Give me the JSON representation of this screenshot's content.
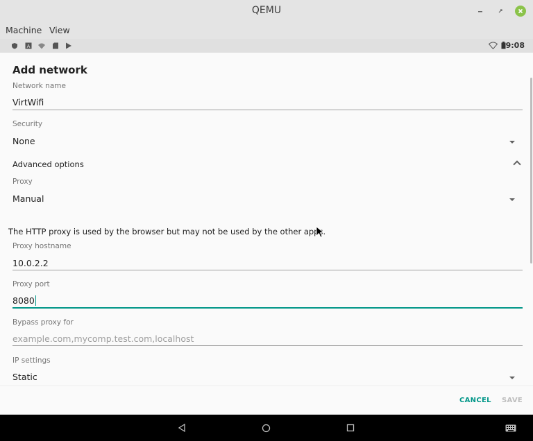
{
  "window": {
    "title": "QEMU",
    "menu": [
      "Machine",
      "View"
    ]
  },
  "statusbar": {
    "left_icons": [
      "shield-icon",
      "font-icon",
      "wifi-off-icon",
      "sdcard-icon",
      "play-store-icon"
    ],
    "time": "9:08"
  },
  "dialog": {
    "title": "Add network",
    "network_name": {
      "label": "Network name",
      "value": "VirtWifi"
    },
    "security": {
      "label": "Security",
      "value": "None"
    },
    "advanced_options": "Advanced options",
    "proxy": {
      "label": "Proxy",
      "value": "Manual"
    },
    "proxy_note": "The HTTP proxy is used by the browser but may not be used by the other apps.",
    "proxy_hostname": {
      "label": "Proxy hostname",
      "value": "10.0.2.2"
    },
    "proxy_port": {
      "label": "Proxy port",
      "value": "8080"
    },
    "bypass_proxy": {
      "label": "Bypass proxy for",
      "placeholder": "example.com,mycomp.test.com,localhost"
    },
    "ip_settings": {
      "label": "IP settings",
      "value": "Static"
    },
    "actions": {
      "cancel": "CANCEL",
      "save": "SAVE"
    }
  },
  "colors": {
    "accent": "#009688",
    "disabled": "#bdbdbd",
    "window_close": "#8bc34a"
  }
}
